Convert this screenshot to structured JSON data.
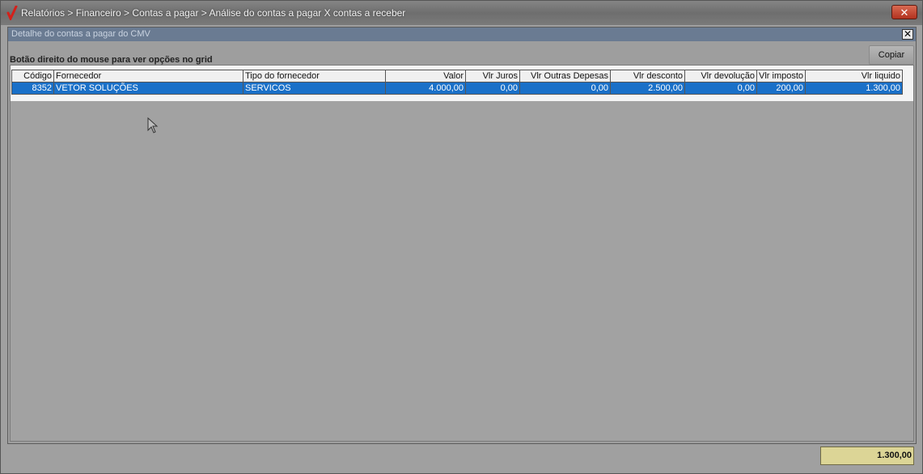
{
  "window": {
    "title": "Relatórios > Financeiro > Contas a pagar > Análise do contas a pagar X contas a receber",
    "close_label": "✕"
  },
  "dialog": {
    "title": "Detalhe do contas a pagar do CMV",
    "close_label": "✕",
    "hint": "Botão direito do mouse para ver opções no grid",
    "copy_label": "Copiar"
  },
  "grid": {
    "columns": [
      "Código",
      "Fornecedor",
      "Tipo do fornecedor",
      "Valor",
      "Vlr Juros",
      "Vlr Outras Depesas",
      "Vlr desconto",
      "Vlr devolução",
      "Vlr imposto",
      "Vlr liquido"
    ],
    "rows": [
      [
        "8352",
        "VETOR SOLUÇÕES",
        "SERVICOS",
        "4.000,00",
        "0,00",
        "0,00",
        "2.500,00",
        "0,00",
        "200,00",
        "1.300,00"
      ]
    ]
  },
  "total": "1.300,00",
  "colors": {
    "selected_row": "#1a70c8",
    "total_bg": "#dcd596",
    "close_button": "#c0402a"
  },
  "icons": {
    "app": "red-check-icon",
    "cursor": "mouse-pointer-icon"
  }
}
